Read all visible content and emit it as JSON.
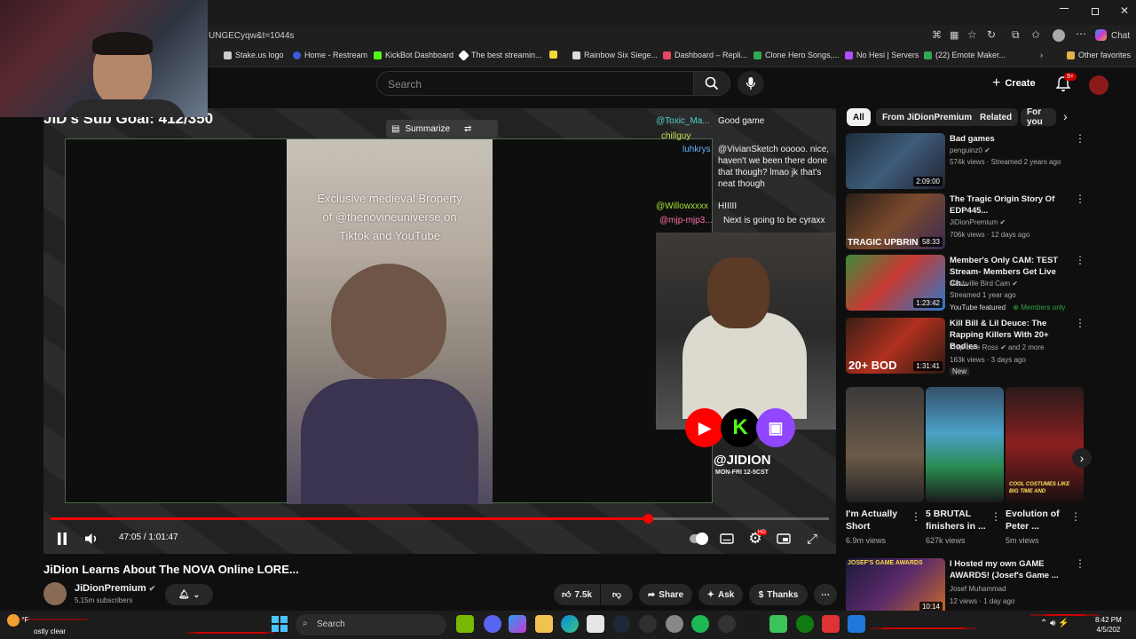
{
  "browser": {
    "url": "UNGECyqw&t=1044s",
    "chat_label": "Chat",
    "bookmarks": [
      {
        "label": "Stake.us logo",
        "color": "#cccccc"
      },
      {
        "label": "Home - Restream",
        "color": "#3b5bdb"
      },
      {
        "label": "KickBot Dashboard",
        "color": "#53fc18"
      },
      {
        "label": "The best streamin...",
        "color": "#ffffff"
      },
      {
        "label": "",
        "color": "#f7d73a"
      },
      {
        "label": "Rainbow Six Siege...",
        "color": "#dddddd"
      },
      {
        "label": "Dashboard – Repli...",
        "color": "#e8475f"
      },
      {
        "label": "Clone Hero Songs,...",
        "color": "#34a853"
      },
      {
        "label": "No Hesi | Servers",
        "color": "#b44cff"
      },
      {
        "label": "(22) Emote Maker...",
        "color": "#34a853"
      }
    ],
    "other_favorites": "Other favorites"
  },
  "youtube_header": {
    "search_placeholder": "Search",
    "create_label": "Create",
    "notification_count": "9+"
  },
  "player": {
    "sub_goal": "JID's Sub Goal: 412/350",
    "summarize_label": "Summarize",
    "tiktok_text_line1": "Exclusive medieval Broperty",
    "tiktok_text_line2": "of @thenovineuniverse on",
    "tiktok_text_line3": "Tiktok and YouTube",
    "chat": [
      {
        "user": "@Toxic_Ma...",
        "msg": "Good game"
      },
      {
        "user": "chillguy",
        "msg": ""
      },
      {
        "user": "luhkrys",
        "msg": "@VivianSketch ooooo. nice, haven't we been there done that though? lmao jk that's neat though"
      },
      {
        "user": "",
        "msg": "HIIIII"
      },
      {
        "user": "@Willowxxxx",
        "msg": ""
      },
      {
        "user": "@mjp-mjp3...",
        "msg": "Next is going to be cyraxx"
      }
    ],
    "handle": "@JIDION",
    "schedule": "MON-FRI 12-5CST",
    "progress": 0.767,
    "current_time": "47:05",
    "duration": "1:01:47",
    "time_display": "47:05 / 1:01:47",
    "hd_badge": "HD"
  },
  "video": {
    "title": "JiDion Learns About The NOVA Online LORE...",
    "channel": "JiDionPremium",
    "subscribers": "5.15m subscribers",
    "likes": "7.5k",
    "share_label": "Share",
    "ask_label": "Ask",
    "thanks_label": "Thanks"
  },
  "sidebar": {
    "chips": [
      "All",
      "From JiDionPremium",
      "Related",
      "For you"
    ],
    "recommendations": [
      {
        "title": "Bad games",
        "channel": "penguinz0",
        "meta": "574k views · Streamed 2 years ago",
        "duration": "2:09:00",
        "badge": ""
      },
      {
        "title": "The Tragic Origin Story Of EDP445...",
        "channel": "JiDionPremium",
        "meta": "706k views · 12 days ago",
        "duration": "58:33",
        "badge": ""
      },
      {
        "title": "Member's Only CAM: TEST Stream- Members Get Live Ch...",
        "channel": "Nashville Bird Cam",
        "meta": "Streamed 1 year ago",
        "duration": "1:23:42",
        "badge": "YouTube featured",
        "members": "Members only"
      },
      {
        "title": "Kill Bill & Lil Deuce: The Rapping Killers With 20+ Bodies",
        "channel": "Trap Lore Ross",
        "channel_extra": "and 2 more",
        "meta": "163k views · 3 days ago",
        "duration": "1:31:41",
        "badge": "New"
      }
    ],
    "shorts": [
      {
        "title": "I'm Actually Short",
        "views": "6.9m views"
      },
      {
        "title": "5 BRUTAL finishers in ...",
        "views": "627k views"
      },
      {
        "title": "Evolution of Peter ...",
        "views": "5m views"
      }
    ],
    "shorts_overlay": "COOL COSTUMES LIKE BIG TIME AND",
    "last": {
      "title": "I Hosted my own GAME AWARDS! (Josef's Game ...",
      "channel": "Josef Muhammad",
      "meta": "12 views · 1 day ago",
      "duration": "10:14",
      "thumb_text": "JOSEF'S GAME AWARDS"
    }
  },
  "thumb_text": {
    "tragic": "TRAGIC UPBRIN",
    "bodies": "20+ BOD"
  },
  "taskbar": {
    "weather_temp": "°F",
    "weather_desc": "ostly clear",
    "search_placeholder": "Search",
    "time": "8:42 PM",
    "date": "4/5/202"
  }
}
